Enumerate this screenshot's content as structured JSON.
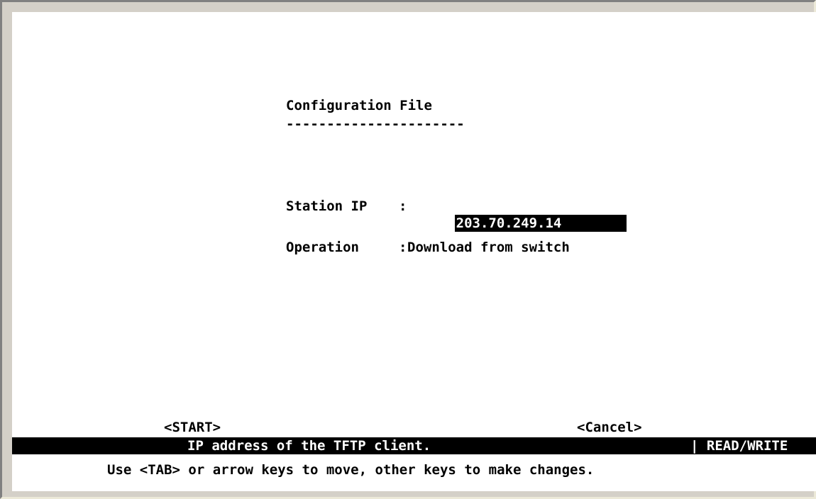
{
  "screen": {
    "title": "Configuration File",
    "title_underline": "----------------------"
  },
  "fields": {
    "station_ip": {
      "label": "Station IP",
      "separator": ":",
      "value": "203.70.249.14"
    },
    "operation": {
      "label": "Operation",
      "separator": ":",
      "value": "Download from switch"
    }
  },
  "actions": {
    "start_label": "<START>",
    "cancel_label": "<Cancel>"
  },
  "status_bar": {
    "help_text": "IP address of the TFTP client.",
    "access_mode": "| READ/WRITE"
  },
  "footer": {
    "hint": "Use <TAB> or arrow keys to move, other keys to make changes."
  },
  "colors": {
    "background": "#ffffff",
    "text": "#000000",
    "highlight_bg": "#000000",
    "highlight_text": "#ffffff",
    "window_frame": "#d4d0c8"
  }
}
